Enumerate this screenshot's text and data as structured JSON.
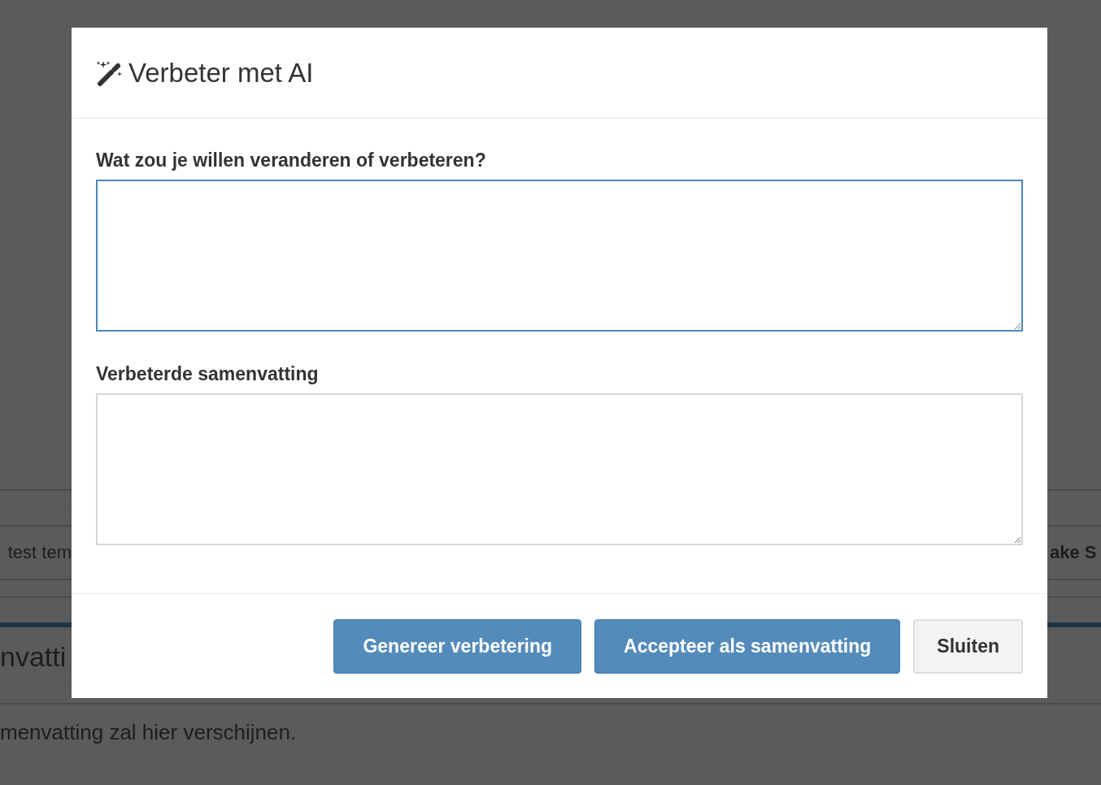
{
  "background_page": {
    "table_row": {
      "column_1": "test tem",
      "column_2": "ake S"
    },
    "section_heading": "nvatti",
    "message": "menvatting zal hier verschijnen."
  },
  "dialog": {
    "title": "Verbeter met AI",
    "fields": [
      {
        "label": "Wat zou je willen veranderen of verbeteren?",
        "focused": true
      },
      {
        "label": "Verbeterde samenvatting",
        "focused": false
      }
    ],
    "buttons": [
      {
        "label": "Genereer verbetering",
        "kind": "primary"
      },
      {
        "label": "Accepteer als samenvatting",
        "kind": "primary"
      },
      {
        "label": "Sluiten",
        "kind": "default"
      }
    ]
  }
}
